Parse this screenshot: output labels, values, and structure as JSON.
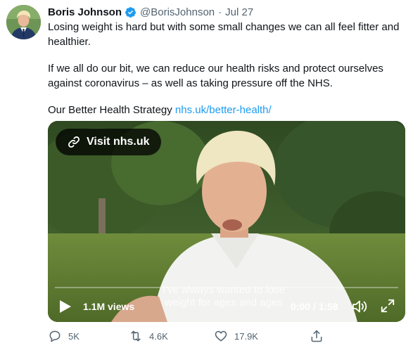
{
  "author": {
    "name": "Boris Johnson",
    "handle": "@BorisJohnson",
    "separator": "·",
    "date": "Jul 27",
    "verified": true
  },
  "tweet": {
    "paragraph_1": "Losing weight is hard but with some small changes we can all feel fitter and healthier.",
    "paragraph_2": "If we all do our bit, we can reduce our health risks and protect ourselves against coronavirus – as well as taking pressure off the NHS.",
    "paragraph_3_text": "Our Better Health Strategy ",
    "paragraph_3_link": "nhs.uk/better-health/"
  },
  "video": {
    "visit_label": "Visit nhs.uk",
    "caption_line_1": "I've always wanted to lose",
    "caption_line_2": "weight for ages and ages",
    "views": "1.1M views",
    "time": "0:00 / 1:58",
    "progress": 0
  },
  "actions": {
    "replies": "5K",
    "retweets": "4.6K",
    "likes": "17.9K"
  },
  "colors": {
    "accent": "#1d9bf0",
    "text": "#0f1419",
    "muted": "#536471"
  },
  "icons": {
    "verified": "verified-badge-icon",
    "link": "link-icon",
    "play": "play-icon",
    "volume": "volume-icon",
    "fullscreen": "fullscreen-icon",
    "reply": "reply-icon",
    "retweet": "retweet-icon",
    "like": "heart-icon",
    "share": "share-icon"
  }
}
